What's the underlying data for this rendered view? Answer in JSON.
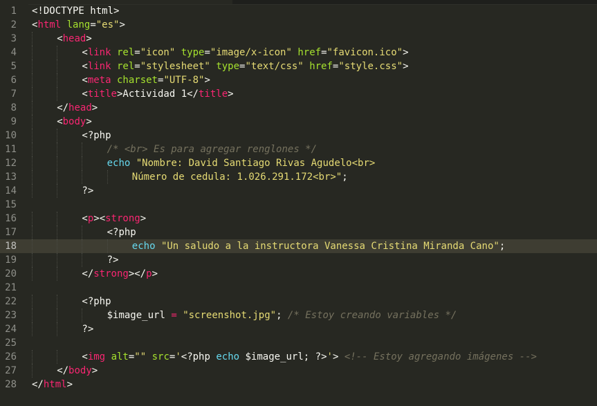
{
  "editor": {
    "theme_colors": {
      "background": "#272822",
      "text": "#f8f8f2",
      "tag": "#f92672",
      "attribute": "#a6e22e",
      "string": "#e6db74",
      "comment": "#75715e",
      "keyword": "#66d9ef",
      "line_number": "#8f908a",
      "active_line": "#3e3d32"
    },
    "active_line": 18,
    "lines": [
      {
        "n": "1",
        "indent": 0,
        "tokens": [
          [
            "txt",
            "<!DOCTYPE html>"
          ]
        ]
      },
      {
        "n": "2",
        "indent": 0,
        "tokens": [
          [
            "txt",
            "<"
          ],
          [
            "tag",
            "html"
          ],
          [
            "txt",
            " "
          ],
          [
            "attr",
            "lang"
          ],
          [
            "txt",
            "="
          ],
          [
            "str",
            "\"es\""
          ],
          [
            "txt",
            ">"
          ]
        ]
      },
      {
        "n": "3",
        "indent": 1,
        "tokens": [
          [
            "txt",
            "<"
          ],
          [
            "tag",
            "head"
          ],
          [
            "txt",
            ">"
          ]
        ]
      },
      {
        "n": "4",
        "indent": 2,
        "tokens": [
          [
            "txt",
            "<"
          ],
          [
            "tag",
            "link"
          ],
          [
            "txt",
            " "
          ],
          [
            "attr",
            "rel"
          ],
          [
            "txt",
            "="
          ],
          [
            "str",
            "\"icon\""
          ],
          [
            "txt",
            " "
          ],
          [
            "attr",
            "type"
          ],
          [
            "txt",
            "="
          ],
          [
            "str",
            "\"image/x-icon\""
          ],
          [
            "txt",
            " "
          ],
          [
            "attr",
            "href"
          ],
          [
            "txt",
            "="
          ],
          [
            "str",
            "\"favicon.ico\""
          ],
          [
            "txt",
            ">"
          ]
        ]
      },
      {
        "n": "5",
        "indent": 2,
        "tokens": [
          [
            "txt",
            "<"
          ],
          [
            "tag",
            "link"
          ],
          [
            "txt",
            " "
          ],
          [
            "attr",
            "rel"
          ],
          [
            "txt",
            "="
          ],
          [
            "str",
            "\"stylesheet\""
          ],
          [
            "txt",
            " "
          ],
          [
            "attr",
            "type"
          ],
          [
            "txt",
            "="
          ],
          [
            "str",
            "\"text/css\""
          ],
          [
            "txt",
            " "
          ],
          [
            "attr",
            "href"
          ],
          [
            "txt",
            "="
          ],
          [
            "str",
            "\"style.css\""
          ],
          [
            "txt",
            ">"
          ]
        ]
      },
      {
        "n": "6",
        "indent": 2,
        "tokens": [
          [
            "txt",
            "<"
          ],
          [
            "tag",
            "meta"
          ],
          [
            "txt",
            " "
          ],
          [
            "attr",
            "charset"
          ],
          [
            "txt",
            "="
          ],
          [
            "str",
            "\"UTF-8\""
          ],
          [
            "txt",
            ">"
          ]
        ]
      },
      {
        "n": "7",
        "indent": 2,
        "tokens": [
          [
            "txt",
            "<"
          ],
          [
            "tag",
            "title"
          ],
          [
            "txt",
            ">Actividad 1</"
          ],
          [
            "tag",
            "title"
          ],
          [
            "txt",
            ">"
          ]
        ]
      },
      {
        "n": "8",
        "indent": 1,
        "tokens": [
          [
            "txt",
            "</"
          ],
          [
            "tag",
            "head"
          ],
          [
            "txt",
            ">"
          ]
        ]
      },
      {
        "n": "9",
        "indent": 1,
        "tokens": [
          [
            "txt",
            "<"
          ],
          [
            "tag",
            "body"
          ],
          [
            "txt",
            ">"
          ]
        ]
      },
      {
        "n": "10",
        "indent": 2,
        "tokens": [
          [
            "php",
            "<?php"
          ]
        ]
      },
      {
        "n": "11",
        "indent": 3,
        "tokens": [
          [
            "cmt",
            "/* <br> Es para agregar renglones */"
          ]
        ]
      },
      {
        "n": "12",
        "indent": 3,
        "tokens": [
          [
            "kw",
            "echo"
          ],
          [
            "txt",
            " "
          ],
          [
            "str",
            "\"Nombre: David Santiago Rivas Agudelo<br>"
          ]
        ]
      },
      {
        "n": "13",
        "indent": 4,
        "tokens": [
          [
            "str",
            "Número de cedula: 1.026.291.172<br>\""
          ],
          [
            "txt",
            ";"
          ]
        ]
      },
      {
        "n": "14",
        "indent": 2,
        "tokens": [
          [
            "php",
            "?>"
          ]
        ]
      },
      {
        "n": "15",
        "indent": 0,
        "tokens": []
      },
      {
        "n": "16",
        "indent": 2,
        "tokens": [
          [
            "txt",
            "<"
          ],
          [
            "tag",
            "p"
          ],
          [
            "txt",
            "><"
          ],
          [
            "tag",
            "strong"
          ],
          [
            "txt",
            ">"
          ]
        ]
      },
      {
        "n": "17",
        "indent": 3,
        "tokens": [
          [
            "php",
            "<?php"
          ]
        ]
      },
      {
        "n": "18",
        "indent": 4,
        "tokens": [
          [
            "kw",
            "echo"
          ],
          [
            "txt",
            " "
          ],
          [
            "str",
            "\"Un saludo a la instructora Vanessa Cristina Miranda Cano\""
          ],
          [
            "txt",
            ";"
          ]
        ]
      },
      {
        "n": "19",
        "indent": 3,
        "tokens": [
          [
            "php",
            "?>"
          ]
        ]
      },
      {
        "n": "20",
        "indent": 2,
        "tokens": [
          [
            "txt",
            "</"
          ],
          [
            "tag",
            "strong"
          ],
          [
            "txt",
            "></"
          ],
          [
            "tag",
            "p"
          ],
          [
            "txt",
            ">"
          ]
        ]
      },
      {
        "n": "21",
        "indent": 0,
        "tokens": []
      },
      {
        "n": "22",
        "indent": 2,
        "tokens": [
          [
            "php",
            "<?php"
          ]
        ]
      },
      {
        "n": "23",
        "indent": 3,
        "tokens": [
          [
            "txt",
            "$image_url"
          ],
          [
            "txt",
            " "
          ],
          [
            "op",
            "="
          ],
          [
            "txt",
            " "
          ],
          [
            "str",
            "\"screenshot.jpg\""
          ],
          [
            "txt",
            "; "
          ],
          [
            "cmt",
            "/* Estoy creando variables */"
          ]
        ]
      },
      {
        "n": "24",
        "indent": 2,
        "tokens": [
          [
            "php",
            "?>"
          ]
        ]
      },
      {
        "n": "25",
        "indent": 0,
        "tokens": []
      },
      {
        "n": "26",
        "indent": 2,
        "tokens": [
          [
            "txt",
            "<"
          ],
          [
            "tag",
            "img"
          ],
          [
            "txt",
            " "
          ],
          [
            "attr",
            "alt"
          ],
          [
            "txt",
            "="
          ],
          [
            "str",
            "\"\""
          ],
          [
            "txt",
            " "
          ],
          [
            "attr",
            "src"
          ],
          [
            "txt",
            "="
          ],
          [
            "str",
            "'"
          ],
          [
            "php",
            "<?php"
          ],
          [
            "txt",
            " "
          ],
          [
            "kw",
            "echo"
          ],
          [
            "txt",
            " $image_url; "
          ],
          [
            "php",
            "?>"
          ],
          [
            "str",
            "'"
          ],
          [
            "txt",
            "> "
          ],
          [
            "cmt",
            "<!-- Estoy agregando imágenes -->"
          ]
        ]
      },
      {
        "n": "27",
        "indent": 1,
        "tokens": [
          [
            "txt",
            "</"
          ],
          [
            "tag",
            "body"
          ],
          [
            "txt",
            ">"
          ]
        ]
      },
      {
        "n": "28",
        "indent": 0,
        "tokens": [
          [
            "txt",
            "</"
          ],
          [
            "tag",
            "html"
          ],
          [
            "txt",
            ">"
          ]
        ]
      }
    ]
  }
}
